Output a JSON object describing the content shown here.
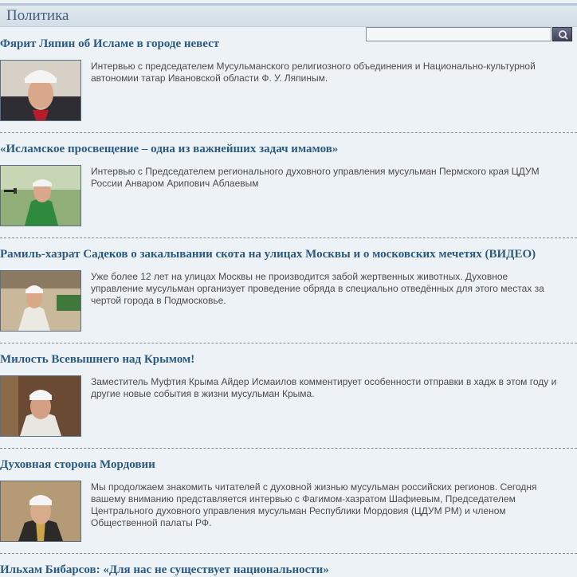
{
  "section": {
    "title": "Политика"
  },
  "search": {
    "value": "",
    "placeholder": "",
    "button_icon": "magnifier-icon"
  },
  "articles": [
    {
      "title": "Фярит Ляпин об Исламе в городе невест",
      "excerpt": "Интервью с председателем Мусульманского религиозного объединения и Национально-культурной автономии татар Ивановской области Ф. У. Ляпиным."
    },
    {
      "title": "«Исламское просвещение – одна из важнейших задач имамов»",
      "excerpt": "Интервью с Председателем регионального духовного управления мусульман Пермского края ЦДУМ России Анваром Арипович Аблаевым"
    },
    {
      "title": "Рамиль-хазрат Садеков о закалывании скота на улицах Москвы и о московских мечетях (ВИДЕО)",
      "excerpt": "Уже более 12 лет на улицах Москвы не производится забой жертвенных животных. Духовное управление мусульман организует проведение обряда в специально отведённых для этого местах за чертой города в Подмосковье."
    },
    {
      "title": "Милость Всевышнего над Крымом!",
      "excerpt": "Заместитель Муфтия Крыма Айдер Исмаилов комментирует особенности отправки в хадж в этом году и другие новые события в жизни мусульман Крыма."
    },
    {
      "title": "Духовная сторона Мордовии",
      "excerpt": "Мы продолжаем знакомить читателей с духовной жизнью мусульман российских регионов. Сегодня вашему вниманию представляется интервью с Фагимом-хазратом Шафиевым, Председателем Центрального духовного управления мусульман Республики Мордовия (ЦДУМ РМ) и членом Общественной палаты РФ."
    },
    {
      "title": "Ильхам Бибарсов: «Для нас не существует национальности»",
      "excerpt": ""
    }
  ],
  "colors": {
    "background": "#edf2f7",
    "title_link": "#2a5a82",
    "header_text": "#45607a",
    "body_text": "#4b4b4b"
  }
}
